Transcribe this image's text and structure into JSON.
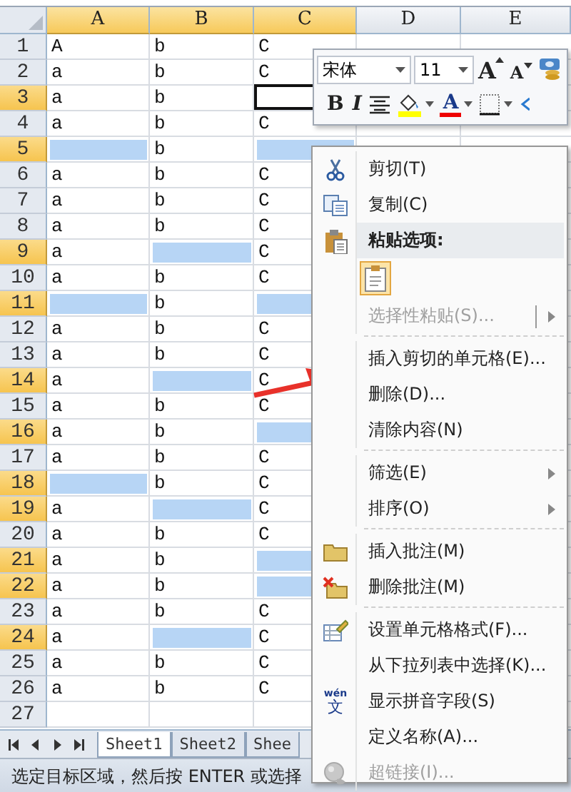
{
  "columns": [
    {
      "label": "A",
      "selected": true
    },
    {
      "label": "B",
      "selected": true
    },
    {
      "label": "C",
      "selected": true
    },
    {
      "label": "D",
      "selected": false
    },
    {
      "label": "E",
      "selected": false
    }
  ],
  "rows": [
    {
      "label": "1",
      "selected": false,
      "cells": [
        {
          "text": "A",
          "highlighted": false,
          "active": false
        },
        {
          "text": "b",
          "highlighted": false,
          "active": false
        },
        {
          "text": "C",
          "highlighted": false,
          "active": false
        }
      ]
    },
    {
      "label": "2",
      "selected": false,
      "cells": [
        {
          "text": "a",
          "highlighted": false,
          "active": false
        },
        {
          "text": "b",
          "highlighted": false,
          "active": false
        },
        {
          "text": "C",
          "highlighted": false,
          "active": false
        }
      ]
    },
    {
      "label": "3",
      "selected": true,
      "cells": [
        {
          "text": "a",
          "highlighted": false,
          "active": false
        },
        {
          "text": "b",
          "highlighted": false,
          "active": false
        },
        {
          "highlighted": false,
          "active": true
        }
      ]
    },
    {
      "label": "4",
      "selected": false,
      "cells": [
        {
          "text": "a",
          "highlighted": false,
          "active": false
        },
        {
          "text": "b",
          "highlighted": false,
          "active": false
        },
        {
          "text": "C",
          "highlighted": false,
          "active": false
        }
      ]
    },
    {
      "label": "5",
      "selected": true,
      "cells": [
        {
          "highlighted": true,
          "active": false
        },
        {
          "text": "b",
          "highlighted": false,
          "active": false
        },
        {
          "highlighted": true,
          "active": false
        }
      ]
    },
    {
      "label": "6",
      "selected": false,
      "cells": [
        {
          "text": "a",
          "highlighted": false,
          "active": false
        },
        {
          "text": "b",
          "highlighted": false,
          "active": false
        },
        {
          "text": "C",
          "highlighted": false,
          "active": false
        }
      ]
    },
    {
      "label": "7",
      "selected": false,
      "cells": [
        {
          "text": "a",
          "highlighted": false,
          "active": false
        },
        {
          "text": "b",
          "highlighted": false,
          "active": false
        },
        {
          "text": "C",
          "highlighted": false,
          "active": false
        }
      ]
    },
    {
      "label": "8",
      "selected": false,
      "cells": [
        {
          "text": "a",
          "highlighted": false,
          "active": false
        },
        {
          "text": "b",
          "highlighted": false,
          "active": false
        },
        {
          "text": "C",
          "highlighted": false,
          "active": false
        }
      ]
    },
    {
      "label": "9",
      "selected": true,
      "cells": [
        {
          "text": "a",
          "highlighted": false,
          "active": false
        },
        {
          "highlighted": true,
          "active": false
        },
        {
          "text": "C",
          "highlighted": false,
          "active": false
        }
      ]
    },
    {
      "label": "10",
      "selected": false,
      "cells": [
        {
          "text": "a",
          "highlighted": false,
          "active": false
        },
        {
          "text": "b",
          "highlighted": false,
          "active": false
        },
        {
          "text": "C",
          "highlighted": false,
          "active": false
        }
      ]
    },
    {
      "label": "11",
      "selected": true,
      "cells": [
        {
          "highlighted": true,
          "active": false
        },
        {
          "text": "b",
          "highlighted": false,
          "active": false
        },
        {
          "highlighted": true,
          "active": false
        }
      ]
    },
    {
      "label": "12",
      "selected": false,
      "cells": [
        {
          "text": "a",
          "highlighted": false,
          "active": false
        },
        {
          "text": "b",
          "highlighted": false,
          "active": false
        },
        {
          "text": "C",
          "highlighted": false,
          "active": false
        }
      ]
    },
    {
      "label": "13",
      "selected": false,
      "cells": [
        {
          "text": "a",
          "highlighted": false,
          "active": false
        },
        {
          "text": "b",
          "highlighted": false,
          "active": false
        },
        {
          "text": "C",
          "highlighted": false,
          "active": false
        }
      ]
    },
    {
      "label": "14",
      "selected": true,
      "cells": [
        {
          "text": "a",
          "highlighted": false,
          "active": false
        },
        {
          "highlighted": true,
          "active": false
        },
        {
          "text": "C",
          "highlighted": false,
          "active": false
        }
      ]
    },
    {
      "label": "15",
      "selected": false,
      "cells": [
        {
          "text": "a",
          "highlighted": false,
          "active": false
        },
        {
          "text": "b",
          "highlighted": false,
          "active": false
        },
        {
          "text": "C",
          "highlighted": false,
          "active": false
        }
      ]
    },
    {
      "label": "16",
      "selected": true,
      "cells": [
        {
          "text": "a",
          "highlighted": false,
          "active": false
        },
        {
          "text": "b",
          "highlighted": false,
          "active": false
        },
        {
          "highlighted": true,
          "active": false
        }
      ]
    },
    {
      "label": "17",
      "selected": false,
      "cells": [
        {
          "text": "a",
          "highlighted": false,
          "active": false
        },
        {
          "text": "b",
          "highlighted": false,
          "active": false
        },
        {
          "text": "C",
          "highlighted": false,
          "active": false
        }
      ]
    },
    {
      "label": "18",
      "selected": true,
      "cells": [
        {
          "highlighted": true,
          "active": false
        },
        {
          "text": "b",
          "highlighted": false,
          "active": false
        },
        {
          "text": "C",
          "highlighted": false,
          "active": false
        }
      ]
    },
    {
      "label": "19",
      "selected": true,
      "cells": [
        {
          "text": "a",
          "highlighted": false,
          "active": false
        },
        {
          "highlighted": true,
          "active": false
        },
        {
          "text": "C",
          "highlighted": false,
          "active": false
        }
      ]
    },
    {
      "label": "20",
      "selected": false,
      "cells": [
        {
          "text": "a",
          "highlighted": false,
          "active": false
        },
        {
          "text": "b",
          "highlighted": false,
          "active": false
        },
        {
          "text": "C",
          "highlighted": false,
          "active": false
        }
      ]
    },
    {
      "label": "21",
      "selected": true,
      "cells": [
        {
          "text": "a",
          "highlighted": false,
          "active": false
        },
        {
          "text": "b",
          "highlighted": false,
          "active": false
        },
        {
          "highlighted": true,
          "active": false
        }
      ]
    },
    {
      "label": "22",
      "selected": true,
      "cells": [
        {
          "text": "a",
          "highlighted": false,
          "active": false
        },
        {
          "text": "b",
          "highlighted": false,
          "active": false
        },
        {
          "highlighted": true,
          "active": false
        }
      ]
    },
    {
      "label": "23",
      "selected": false,
      "cells": [
        {
          "text": "a",
          "highlighted": false,
          "active": false
        },
        {
          "text": "b",
          "highlighted": false,
          "active": false
        },
        {
          "text": "C",
          "highlighted": false,
          "active": false
        }
      ]
    },
    {
      "label": "24",
      "selected": true,
      "cells": [
        {
          "text": "a",
          "highlighted": false,
          "active": false
        },
        {
          "highlighted": true,
          "active": false
        },
        {
          "text": "C",
          "highlighted": false,
          "active": false
        }
      ]
    },
    {
      "label": "25",
      "selected": false,
      "cells": [
        {
          "text": "a",
          "highlighted": false,
          "active": false
        },
        {
          "text": "b",
          "highlighted": false,
          "active": false
        },
        {
          "text": "C",
          "highlighted": false,
          "active": false
        }
      ]
    },
    {
      "label": "26",
      "selected": false,
      "cells": [
        {
          "text": "a",
          "highlighted": false,
          "active": false
        },
        {
          "text": "b",
          "highlighted": false,
          "active": false
        },
        {
          "text": "C",
          "highlighted": false,
          "active": false
        }
      ]
    },
    {
      "label": "27",
      "selected": false,
      "cells": []
    }
  ],
  "sheet_tabs": [
    {
      "label": "Sheet1",
      "selected": true
    },
    {
      "label": "Sheet2",
      "selected": false
    },
    {
      "label": "Shee",
      "selected": false
    }
  ],
  "status_bar": "选定目标区域，然后按 ENTER 或选择",
  "mini_toolbar": {
    "font": "宋体",
    "size": "11",
    "row1": [
      {
        "kind": "grow",
        "label": "A"
      },
      {
        "kind": "shrink",
        "label": "A"
      },
      {
        "kind": "accounting"
      }
    ],
    "row2": [
      {
        "kind": "bold",
        "label": "B"
      },
      {
        "kind": "italic",
        "label": "I"
      },
      {
        "kind": "align"
      },
      {
        "kind": "fill",
        "color": "#ffff00"
      },
      {
        "kind": "font-color",
        "label": "A",
        "color": "#ee0000"
      },
      {
        "kind": "borders"
      },
      {
        "kind": "more"
      }
    ]
  },
  "context_menu": [
    {
      "kind": "item",
      "label": "剪切(T)",
      "disabled": false,
      "submenu": false
    },
    {
      "kind": "item",
      "label": "复制(C)",
      "disabled": false,
      "submenu": false
    },
    {
      "kind": "header",
      "label": "粘贴选项:"
    },
    {
      "kind": "paste-options"
    },
    {
      "kind": "item",
      "label": "选择性粘贴(S)...",
      "disabled": true,
      "submenu": true
    },
    {
      "kind": "separator"
    },
    {
      "kind": "item",
      "label": "插入剪切的单元格(E)...",
      "disabled": false,
      "submenu": false
    },
    {
      "kind": "item",
      "label": "删除(D)...",
      "disabled": false,
      "submenu": false
    },
    {
      "kind": "item",
      "label": "清除内容(N)",
      "disabled": false,
      "submenu": false
    },
    {
      "kind": "separator"
    },
    {
      "kind": "item",
      "label": "筛选(E)",
      "disabled": false,
      "submenu": true
    },
    {
      "kind": "item",
      "label": "排序(O)",
      "disabled": false,
      "submenu": true
    },
    {
      "kind": "separator"
    },
    {
      "kind": "item",
      "label": "插入批注(M)",
      "disabled": false,
      "submenu": false
    },
    {
      "kind": "item",
      "label": "删除批注(M)",
      "disabled": false,
      "submenu": false
    },
    {
      "kind": "separator"
    },
    {
      "kind": "item",
      "label": "设置单元格格式(F)...",
      "disabled": false,
      "submenu": false
    },
    {
      "kind": "item",
      "label": "从下拉列表中选择(K)...",
      "disabled": false,
      "submenu": false
    },
    {
      "kind": "item",
      "label": "显示拼音字段(S)",
      "disabled": false,
      "submenu": false,
      "icon_caption": "wén",
      "icon_label": "文"
    },
    {
      "kind": "item",
      "label": "定义名称(A)...",
      "disabled": false,
      "submenu": false
    },
    {
      "kind": "item",
      "label": "超链接(I)...",
      "disabled": true,
      "submenu": false
    }
  ]
}
